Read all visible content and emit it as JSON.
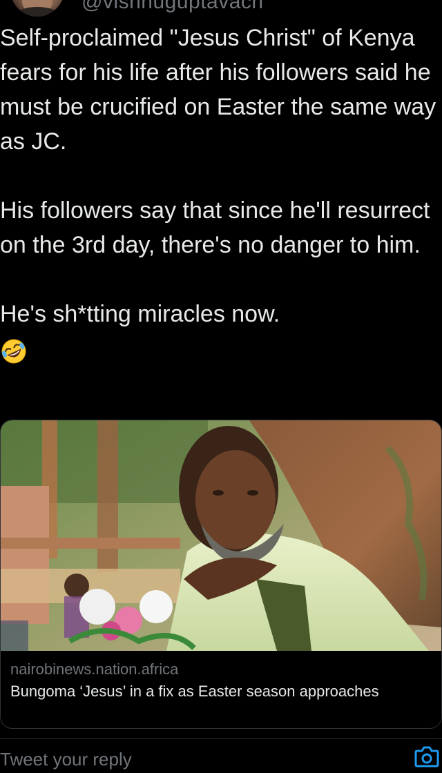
{
  "author": {
    "handle": "@vishnuguptavach",
    "avatar_icon": "profile-photo"
  },
  "tweet": {
    "paragraphs": [
      "Self-proclaimed \"Jesus Christ\" of Kenya fears for his life after his followers said he must be crucified on Easter the same way as JC.",
      "His followers say that since he'll resurrect on the 3rd day, there's no danger to him.",
      "He's sh*tting miracles now."
    ],
    "emoji": "rolling-on-floor-laughing-icon"
  },
  "link_card": {
    "domain": "nairobinews.nation.africa",
    "title": "Bungoma ‘Jesus’ in a fix as Easter season approaches",
    "image_icon": "article-photo"
  },
  "reply": {
    "placeholder": "Tweet your reply",
    "camera_icon": "camera-icon"
  },
  "colors": {
    "background": "#000000",
    "text": "#e7e9ea",
    "secondary_text": "#71767b",
    "border": "#2f3336",
    "accent": "#1d9bf0"
  }
}
